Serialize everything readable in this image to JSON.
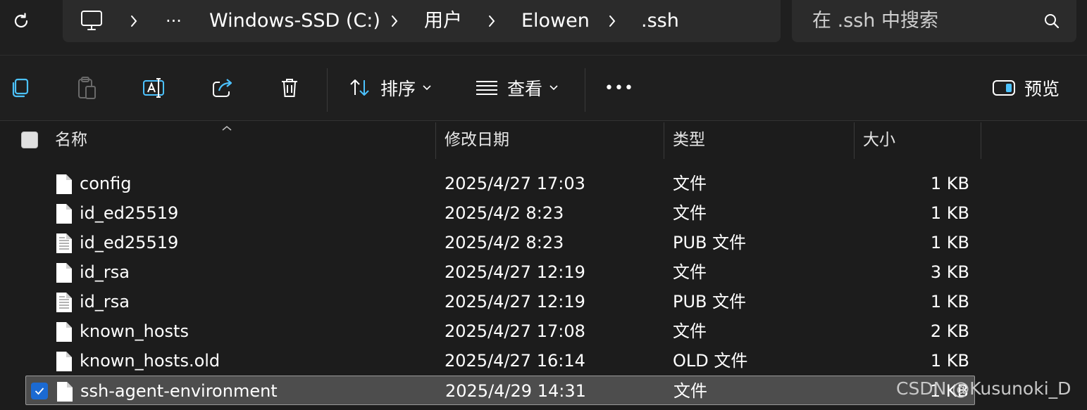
{
  "address": {
    "breadcrumbs": [
      "Windows-SSD (C:)",
      "用户",
      "Elowen",
      ".ssh"
    ],
    "overflow": "···",
    "search_placeholder": "在 .ssh 中搜索"
  },
  "toolbar": {
    "sort_label": "排序",
    "view_label": "查看",
    "more_label": "•••",
    "preview_label": "预览"
  },
  "columns": {
    "name": "名称",
    "modified": "修改日期",
    "type": "类型",
    "size": "大小"
  },
  "files": [
    {
      "name": "config",
      "modified": "2025/4/27 17:03",
      "type": "文件",
      "size": "1 KB",
      "icon": "file-icon",
      "selected": false
    },
    {
      "name": "id_ed25519",
      "modified": "2025/4/2 8:23",
      "type": "文件",
      "size": "1 KB",
      "icon": "file-icon",
      "selected": false
    },
    {
      "name": "id_ed25519",
      "modified": "2025/4/2 8:23",
      "type": "PUB 文件",
      "size": "1 KB",
      "icon": "text-file-icon",
      "selected": false
    },
    {
      "name": "id_rsa",
      "modified": "2025/4/27 12:19",
      "type": "文件",
      "size": "3 KB",
      "icon": "file-icon",
      "selected": false
    },
    {
      "name": "id_rsa",
      "modified": "2025/4/27 12:19",
      "type": "PUB 文件",
      "size": "1 KB",
      "icon": "text-file-icon",
      "selected": false
    },
    {
      "name": "known_hosts",
      "modified": "2025/4/27 17:08",
      "type": "文件",
      "size": "2 KB",
      "icon": "file-icon",
      "selected": false
    },
    {
      "name": "known_hosts.old",
      "modified": "2025/4/27 16:14",
      "type": "OLD 文件",
      "size": "1 KB",
      "icon": "file-icon",
      "selected": false
    },
    {
      "name": "ssh-agent-environment",
      "modified": "2025/4/29 14:31",
      "type": "文件",
      "size": "1 KB",
      "icon": "file-icon",
      "selected": true
    }
  ],
  "watermark": "CSDN @Kusunoki_D",
  "colors": {
    "accent": "#1b6ad2",
    "background": "#1c1c1c",
    "selection": "#4d4d4d"
  }
}
